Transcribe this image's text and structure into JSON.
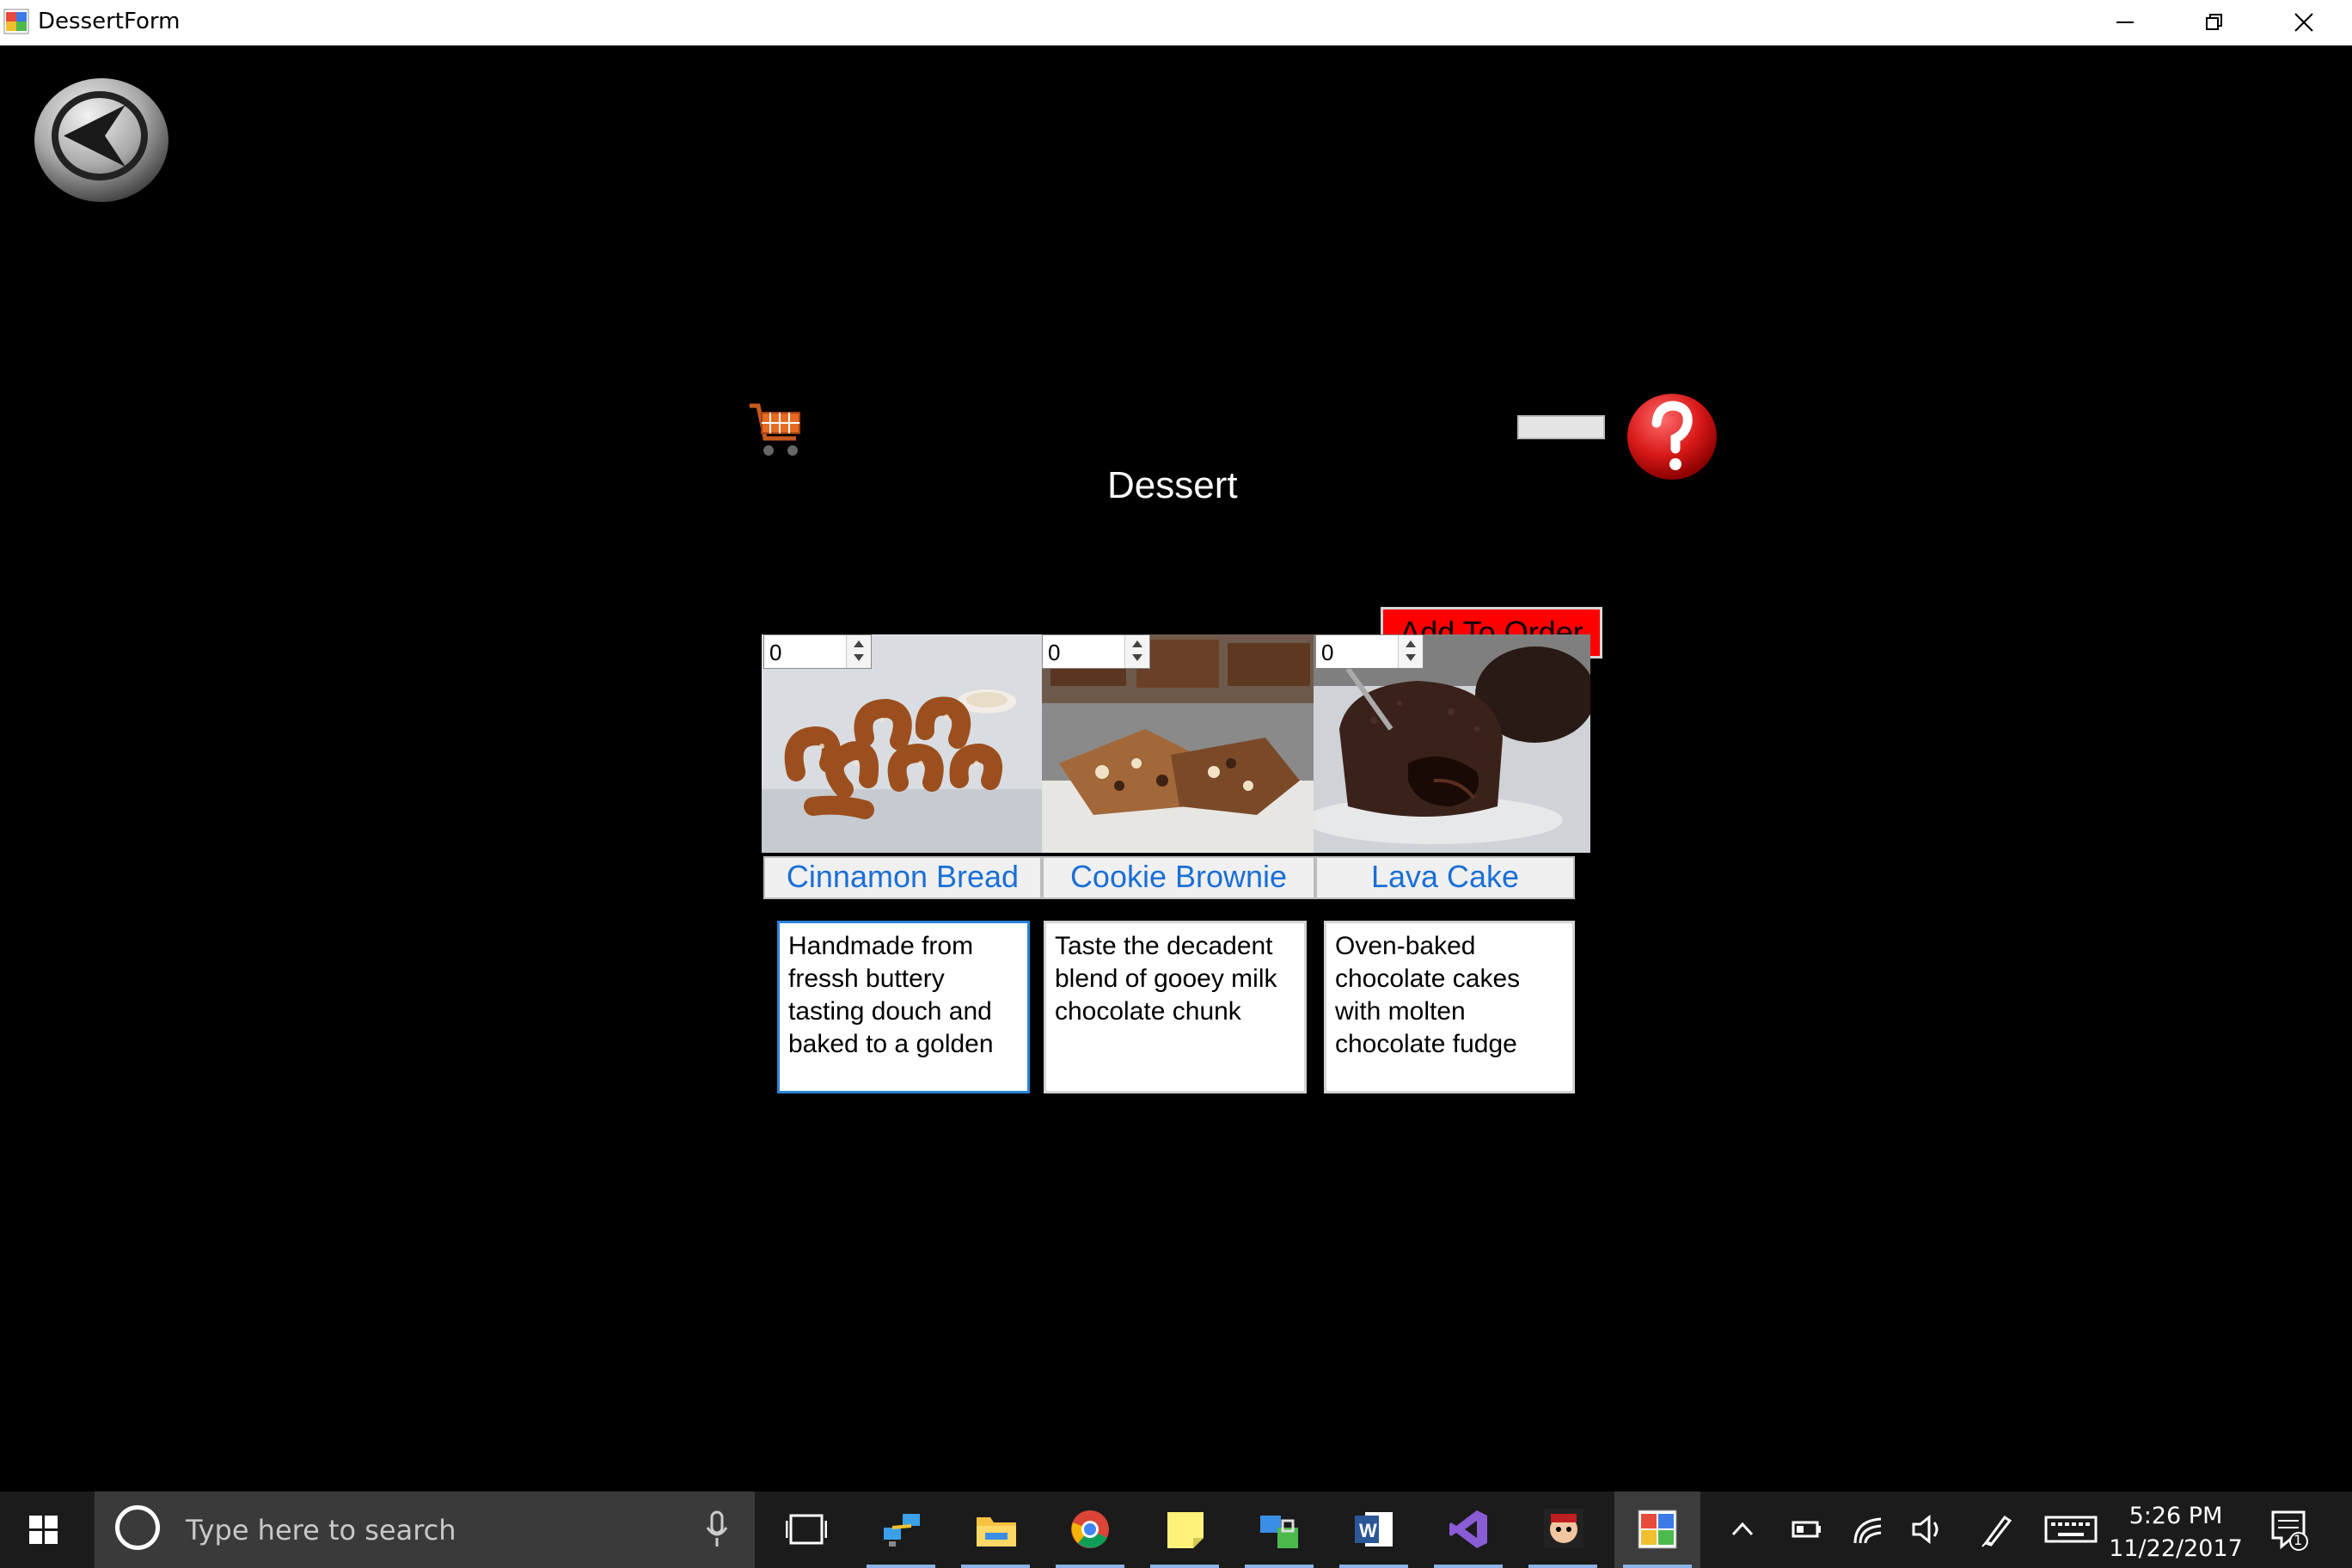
{
  "window": {
    "title": "DessertForm",
    "controls": [
      "minimize",
      "restore",
      "close"
    ]
  },
  "page": {
    "title": "Dessert",
    "add_to_order_label": "Add To Order",
    "icons": {
      "back": "back-arrow-icon",
      "cart": "shopping-cart-icon",
      "help": "help-question-icon"
    }
  },
  "items": [
    {
      "name": "Cinnamon Bread",
      "quantity": "0",
      "description": "Handmade from fressh buttery tasting douch and baked to a golden"
    },
    {
      "name": "Cookie Brownie",
      "quantity": "0",
      "description": "Taste the decadent blend of gooey milk chocolate chunk"
    },
    {
      "name": "Lava Cake",
      "quantity": "0",
      "description": "Oven-baked chocolate cakes with molten chocolate fudge"
    }
  ],
  "taskbar": {
    "search_placeholder": "Type here to search",
    "time": "5:26 PM",
    "date": "11/22/2017",
    "notification_count": "1",
    "apps": [
      "task-view",
      "network-app",
      "file-explorer",
      "chrome",
      "sticky-notes",
      "security-app",
      "word",
      "visual-studio",
      "game-app",
      "dessertform-app"
    ]
  },
  "colors": {
    "background": "#000000",
    "add_to_order": "#ff0000",
    "item_label_text": "#1a6fd6",
    "taskbar": "#1b1b1b"
  }
}
